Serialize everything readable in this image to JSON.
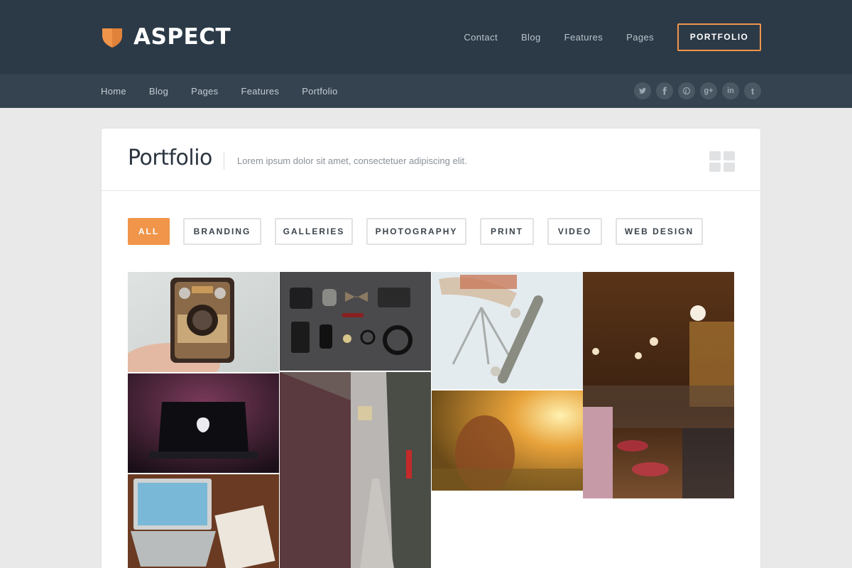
{
  "brand": {
    "name": "ASPECT",
    "accent": "#f0954a"
  },
  "topnav": {
    "links": [
      "Contact",
      "Blog",
      "Features",
      "Pages"
    ],
    "cta": "PORTFOLIO"
  },
  "subnav": {
    "links": [
      "Home",
      "Blog",
      "Pages",
      "Features",
      "Portfolio"
    ],
    "social": [
      {
        "icon": "twitter-icon",
        "glyph": "t"
      },
      {
        "icon": "facebook-icon",
        "glyph": "f"
      },
      {
        "icon": "pinterest-icon",
        "glyph": "p"
      },
      {
        "icon": "google-plus-icon",
        "glyph": "g+"
      },
      {
        "icon": "linkedin-icon",
        "glyph": "in"
      },
      {
        "icon": "tumblr-icon",
        "glyph": "t"
      }
    ]
  },
  "page": {
    "title": "Portfolio",
    "subtitle": "Lorem ipsum dolor sit amet, consectetuer adipiscing elit."
  },
  "filters": {
    "items": [
      "ALL",
      "BRANDING",
      "GALLERIES",
      "PHOTOGRAPHY",
      "PRINT",
      "VIDEO",
      "WEB DESIGN"
    ],
    "active": "ALL"
  },
  "gallery": {
    "items": [
      {
        "name": "vintage-camera-photo"
      },
      {
        "name": "flatlay-accessories-photo"
      },
      {
        "name": "skateboard-chair-photo"
      },
      {
        "name": "cafe-interior-photo"
      },
      {
        "name": "dark-laptop-photo"
      },
      {
        "name": "city-bridge-street-photo"
      },
      {
        "name": "sunset-field-girl-photo"
      },
      {
        "name": "laptop-desk-photo"
      }
    ]
  }
}
